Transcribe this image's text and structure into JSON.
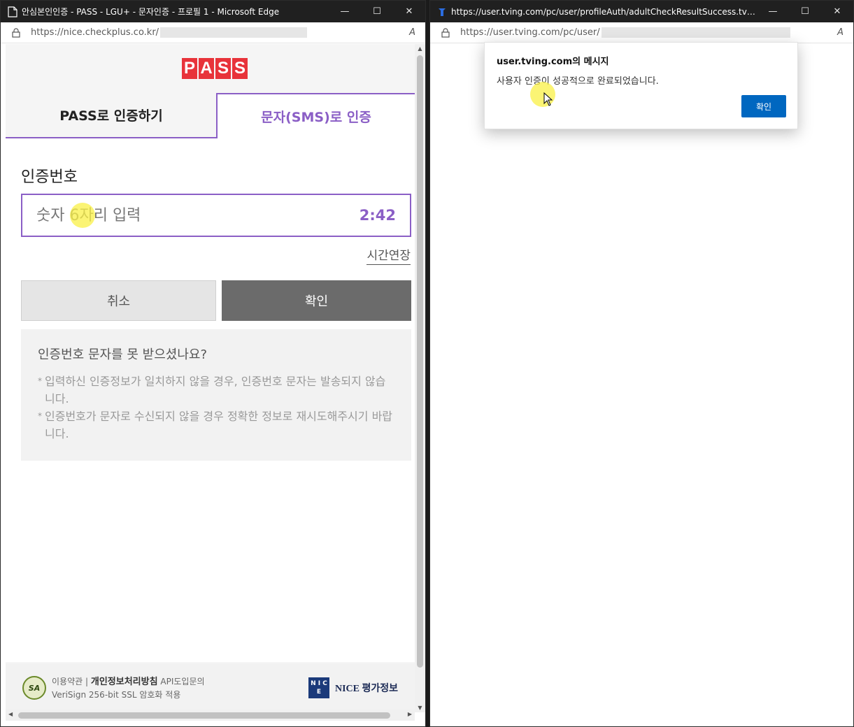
{
  "left_window": {
    "title": "안심본인인증 - PASS - LGU+ - 문자인증 - 프로필 1 - Microsoft Edge",
    "url": "https://nice.checkplus.co.kr/",
    "read_aloud": "A",
    "controls": {
      "minimize": "—",
      "maximize": "☐",
      "close": "✕"
    }
  },
  "pass_page": {
    "logo": [
      "P",
      "A",
      "S",
      "S"
    ],
    "tabs": [
      {
        "label": "PASS로 인증하기",
        "active": false
      },
      {
        "label": "문자(SMS)로 인증",
        "active": true
      }
    ],
    "code_label": "인증번호",
    "code_placeholder": "숫자 6자리 입력",
    "timer": "2:42",
    "extend_time": "시간연장",
    "cancel_button": "취소",
    "confirm_button": "확인",
    "help": {
      "title": "인증번호 문자를 못 받으셨나요?",
      "notes": [
        "입력하신 인증정보가 일치하지 않을 경우, 인증번호 문자는 발송되지 않습니다.",
        "인증번호가 문자로 수신되지 않을 경우 정확한 정보로 재시도해주시기 바랍니다."
      ]
    },
    "footer": {
      "seal": "SA",
      "terms": "이용약관",
      "privacy": "개인정보처리방침",
      "api": "API도입문의",
      "ssl": "VeriSign 256-bit SSL 암호화 적용",
      "nice_logo": "N I C E",
      "nice_label": "NICE 평가정보"
    }
  },
  "right_window": {
    "title": "https://user.tving.com/pc/user/profileAuth/adultCheckResultSuccess.tving - 프로...",
    "url": "https://user.tving.com/pc/user/",
    "read_aloud": "A",
    "controls": {
      "minimize": "—",
      "maximize": "☐",
      "close": "✕"
    }
  },
  "dialog": {
    "title": "user.tving.com의 메시지",
    "message": "사용자 인증이 성공적으로 완료되었습니다.",
    "ok_button": "확인"
  },
  "colors": {
    "accent": "#8b5fc6",
    "pass_red": "#e8333a",
    "dialog_button": "#0067c0",
    "titlebar": "#202020"
  }
}
